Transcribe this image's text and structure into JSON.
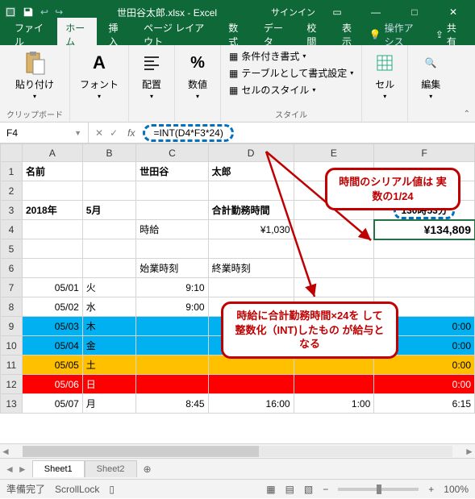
{
  "title_bar": {
    "filename": "世田谷太郎.xlsx - Excel",
    "signin": "サインイン"
  },
  "ribbon_tabs": {
    "file": "ファイル",
    "home": "ホーム",
    "insert": "挿入",
    "page_layout": "ページ レイアウト",
    "formulas": "数式",
    "data": "データ",
    "review": "校閲",
    "view": "表示",
    "help_placeholder": "操作アシス",
    "share": "共有"
  },
  "ribbon": {
    "clipboard": {
      "paste": "貼り付け",
      "label": "クリップボード"
    },
    "font": {
      "btn": "フォント"
    },
    "alignment": {
      "btn": "配置"
    },
    "number": {
      "btn": "数値"
    },
    "styles": {
      "cond_format": "条件付き書式",
      "format_table": "テーブルとして書式設定",
      "cell_styles": "セルのスタイル",
      "label": "スタイル"
    },
    "cells": {
      "btn": "セル"
    },
    "editing": {
      "btn": "編集"
    }
  },
  "namebox": {
    "cell_ref": "F4"
  },
  "formula_bar": {
    "formula": "=INT(D4*F3*24)"
  },
  "headers": {
    "A": "A",
    "B": "B",
    "C": "C",
    "D": "D",
    "E": "E",
    "F": "F"
  },
  "rows": {
    "r1": {
      "A": "名前",
      "C": "世田谷",
      "D": "太郎"
    },
    "r3": {
      "A": "2018年",
      "B": "5月",
      "D": "合計勤務時間",
      "F": "130時53分"
    },
    "r4": {
      "C": "時給",
      "D": "¥1,030",
      "F": "¥134,809"
    },
    "r6": {
      "C": "始業時刻",
      "D": "終業時刻"
    },
    "r7": {
      "A": "05/01",
      "B": "火",
      "C": "9:10"
    },
    "r8": {
      "A": "05/02",
      "B": "水",
      "C": "9:00"
    },
    "r9": {
      "A": "05/03",
      "B": "木",
      "F": "0:00"
    },
    "r10": {
      "A": "05/04",
      "B": "金",
      "F": "0:00"
    },
    "r11": {
      "A": "05/05",
      "B": "土",
      "F": "0:00"
    },
    "r12": {
      "A": "05/06",
      "B": "日",
      "F": "0:00"
    },
    "r13": {
      "A": "05/07",
      "B": "月",
      "C": "8:45",
      "D": "16:00",
      "E": "1:00",
      "F": "6:15"
    }
  },
  "callouts": {
    "top": "時間のシリアル値は\n実数の1/24",
    "mid": "時給に合計勤務時間×24を\nして整数化（INT)したもの\nが給与となる"
  },
  "sheet_tabs": {
    "s1": "Sheet1",
    "s2": "Sheet2"
  },
  "statusbar": {
    "ready": "準備完了",
    "scroll": "ScrollLock",
    "zoom": "100%"
  }
}
